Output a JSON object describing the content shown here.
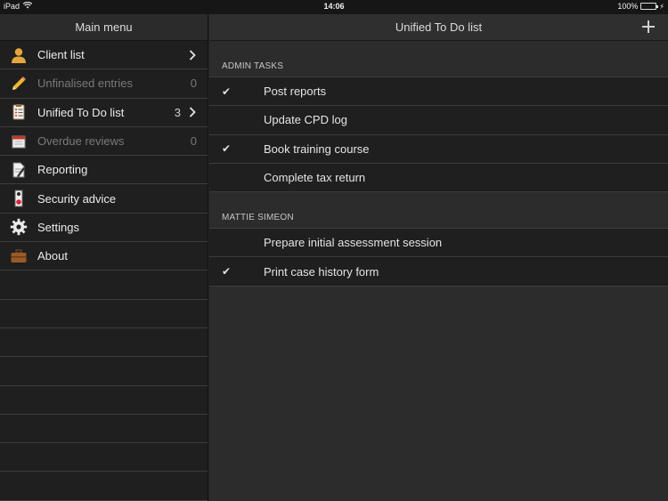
{
  "status": {
    "carrier": "iPad",
    "time": "14:06",
    "battery": "100%",
    "battery_level": 1.0
  },
  "sidebar": {
    "title": "Main menu",
    "items": [
      {
        "label": "Client list",
        "count": "",
        "chevron": true,
        "enabled": true,
        "icon": "person-icon"
      },
      {
        "label": "Unfinalised entries",
        "count": "0",
        "chevron": false,
        "enabled": false,
        "icon": "pencil-icon"
      },
      {
        "label": "Unified To Do list",
        "count": "3",
        "chevron": true,
        "enabled": true,
        "icon": "checklist-icon"
      },
      {
        "label": "Overdue reviews",
        "count": "0",
        "chevron": false,
        "enabled": false,
        "icon": "calendar-icon"
      },
      {
        "label": "Reporting",
        "count": "",
        "chevron": false,
        "enabled": true,
        "icon": "document-pen-icon"
      },
      {
        "label": "Security advice",
        "count": "",
        "chevron": false,
        "enabled": true,
        "icon": "door-hanger-icon"
      },
      {
        "label": "Settings",
        "count": "",
        "chevron": false,
        "enabled": true,
        "icon": "gear-icon"
      },
      {
        "label": "About",
        "count": "",
        "chevron": false,
        "enabled": true,
        "icon": "briefcase-icon"
      }
    ]
  },
  "main": {
    "title": "Unified To Do list",
    "sections": [
      {
        "title": "ADMIN TASKS",
        "tasks": [
          {
            "label": "Post reports",
            "checked": true
          },
          {
            "label": "Update CPD log",
            "checked": false
          },
          {
            "label": "Book training course",
            "checked": true
          },
          {
            "label": "Complete tax return",
            "checked": false
          }
        ]
      },
      {
        "title": "MATTIE SIMEON",
        "tasks": [
          {
            "label": "Prepare initial assessment session",
            "checked": false
          },
          {
            "label": "Print case history form",
            "checked": true
          }
        ]
      }
    ]
  }
}
